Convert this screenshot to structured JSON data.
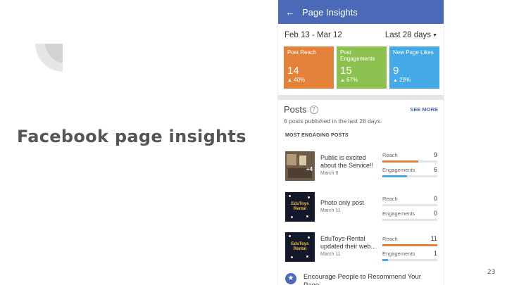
{
  "slide": {
    "title": "Facebook page insights",
    "page_number": "23"
  },
  "app": {
    "back_glyph": "←",
    "header_title": "Page Insights"
  },
  "date_range": {
    "range": "Feb 13 - Mar 12",
    "selector": "Last 28 days",
    "caret": "▼"
  },
  "stat_cards": [
    {
      "label": "Post Reach",
      "value": "14",
      "change": "40%",
      "color": "#e4823a"
    },
    {
      "label": "Post Engagements",
      "value": "15",
      "change": "67%",
      "color": "#8dc14f"
    },
    {
      "label": "New Page Likes",
      "value": "9",
      "change": "29%",
      "color": "#45a8e7"
    }
  ],
  "posts": {
    "title": "Posts",
    "help_glyph": "?",
    "see_more": "SEE MORE",
    "subtitle": "6 posts published in the last 28 days.",
    "section_label": "MOST ENGAGING POSTS",
    "items": [
      {
        "title": "Public is excited about the Service!!",
        "date": "March 8",
        "thumb_overlay": "+4",
        "reach_label": "Reach",
        "reach": "9",
        "reach_fraction": 0.65,
        "eng_label": "Engagements",
        "engagements": "6",
        "eng_fraction": 0.45
      },
      {
        "title": "Photo only post",
        "date": "March 11",
        "thumb_logo": "EduToys Rental",
        "reach_label": "Reach",
        "reach": "0",
        "reach_fraction": 0,
        "eng_label": "Engagements",
        "engagements": "0",
        "eng_fraction": 0
      },
      {
        "title": "EduToys-Rental updated their web...",
        "date": "March 11",
        "thumb_logo": "EduToys Rental",
        "reach_label": "Reach",
        "reach": "11",
        "reach_fraction": 1.0,
        "eng_label": "Engagements",
        "engagements": "1",
        "eng_fraction": 0.1
      }
    ]
  },
  "encourage": {
    "star_glyph": "★",
    "text": "Encourage People to Recommend Your Page"
  },
  "colors": {
    "header_blue": "#4a69b6",
    "reach_bar": "#e4823a",
    "engagement_bar": "#45a8e7"
  },
  "icons": {
    "back": "back-arrow-icon",
    "help": "question-circle-icon",
    "star": "star-icon",
    "up": "triangle-up-icon"
  }
}
